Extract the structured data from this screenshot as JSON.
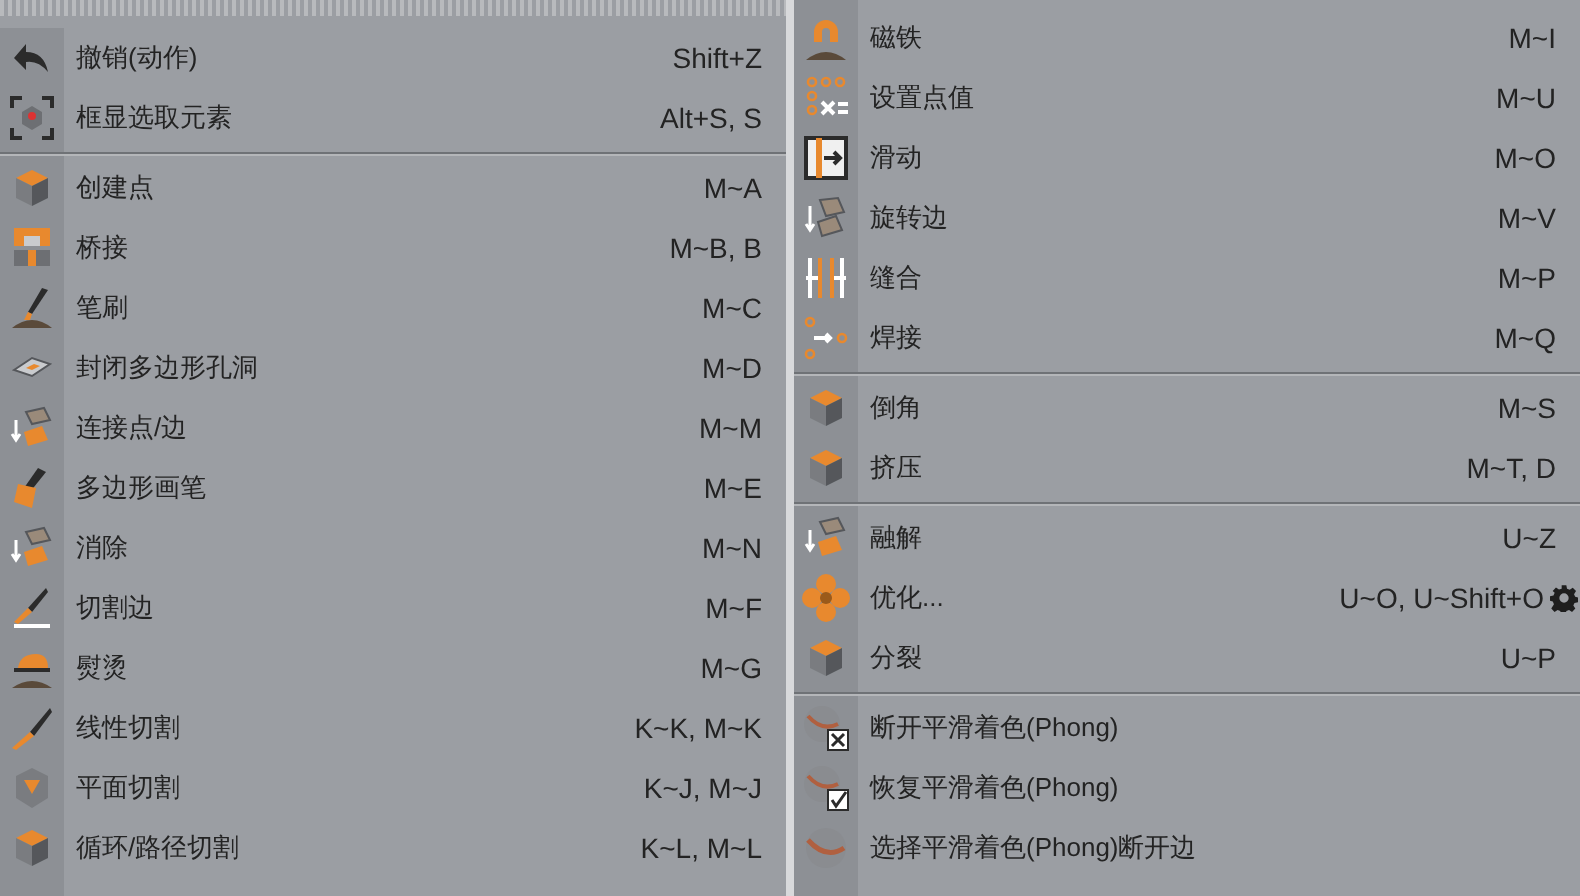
{
  "columns": [
    {
      "tear_off": true,
      "groups": [
        [
          {
            "label": "撤销(动作)",
            "shortcut": "Shift+Z",
            "options": false
          },
          {
            "label": "框显选取元素",
            "shortcut": "Alt+S, S",
            "options": false
          }
        ],
        [
          {
            "label": "创建点",
            "shortcut": "M~A",
            "options": false
          },
          {
            "label": "桥接",
            "shortcut": "M~B, B",
            "options": false
          },
          {
            "label": "笔刷",
            "shortcut": "M~C",
            "options": false
          },
          {
            "label": "封闭多边形孔洞",
            "shortcut": "M~D",
            "options": false
          },
          {
            "label": "连接点/边",
            "shortcut": "M~M",
            "options": false
          },
          {
            "label": "多边形画笔",
            "shortcut": "M~E",
            "options": false
          },
          {
            "label": "消除",
            "shortcut": "M~N",
            "options": false
          },
          {
            "label": "切割边",
            "shortcut": "M~F",
            "options": false
          },
          {
            "label": "熨烫",
            "shortcut": "M~G",
            "options": false
          },
          {
            "label": "线性切割",
            "shortcut": "K~K, M~K",
            "options": false
          },
          {
            "label": "平面切割",
            "shortcut": "K~J, M~J",
            "options": false
          },
          {
            "label": "循环/路径切割",
            "shortcut": "K~L, M~L",
            "options": false
          }
        ]
      ]
    },
    {
      "tear_off": false,
      "groups": [
        [
          {
            "label": "磁铁",
            "shortcut": "M~I",
            "options": false
          },
          {
            "label": "设置点值",
            "shortcut": "M~U",
            "options": false
          },
          {
            "label": "滑动",
            "shortcut": "M~O",
            "options": false
          },
          {
            "label": "旋转边",
            "shortcut": "M~V",
            "options": false
          },
          {
            "label": "缝合",
            "shortcut": "M~P",
            "options": false
          },
          {
            "label": "焊接",
            "shortcut": "M~Q",
            "options": false
          }
        ],
        [
          {
            "label": "倒角",
            "shortcut": "M~S",
            "options": false
          },
          {
            "label": "挤压",
            "shortcut": "M~T, D",
            "options": false
          }
        ],
        [
          {
            "label": "融解",
            "shortcut": "U~Z",
            "options": false
          },
          {
            "label": "优化...",
            "shortcut": "U~O, U~Shift+O",
            "options": true
          },
          {
            "label": "分裂",
            "shortcut": "U~P",
            "options": false
          }
        ],
        [
          {
            "label": "断开平滑着色(Phong)",
            "options": false
          },
          {
            "label": "恢复平滑着色(Phong)",
            "options": false
          },
          {
            "label": "选择平滑着色(Phong)断开边",
            "options": false
          }
        ]
      ]
    }
  ]
}
